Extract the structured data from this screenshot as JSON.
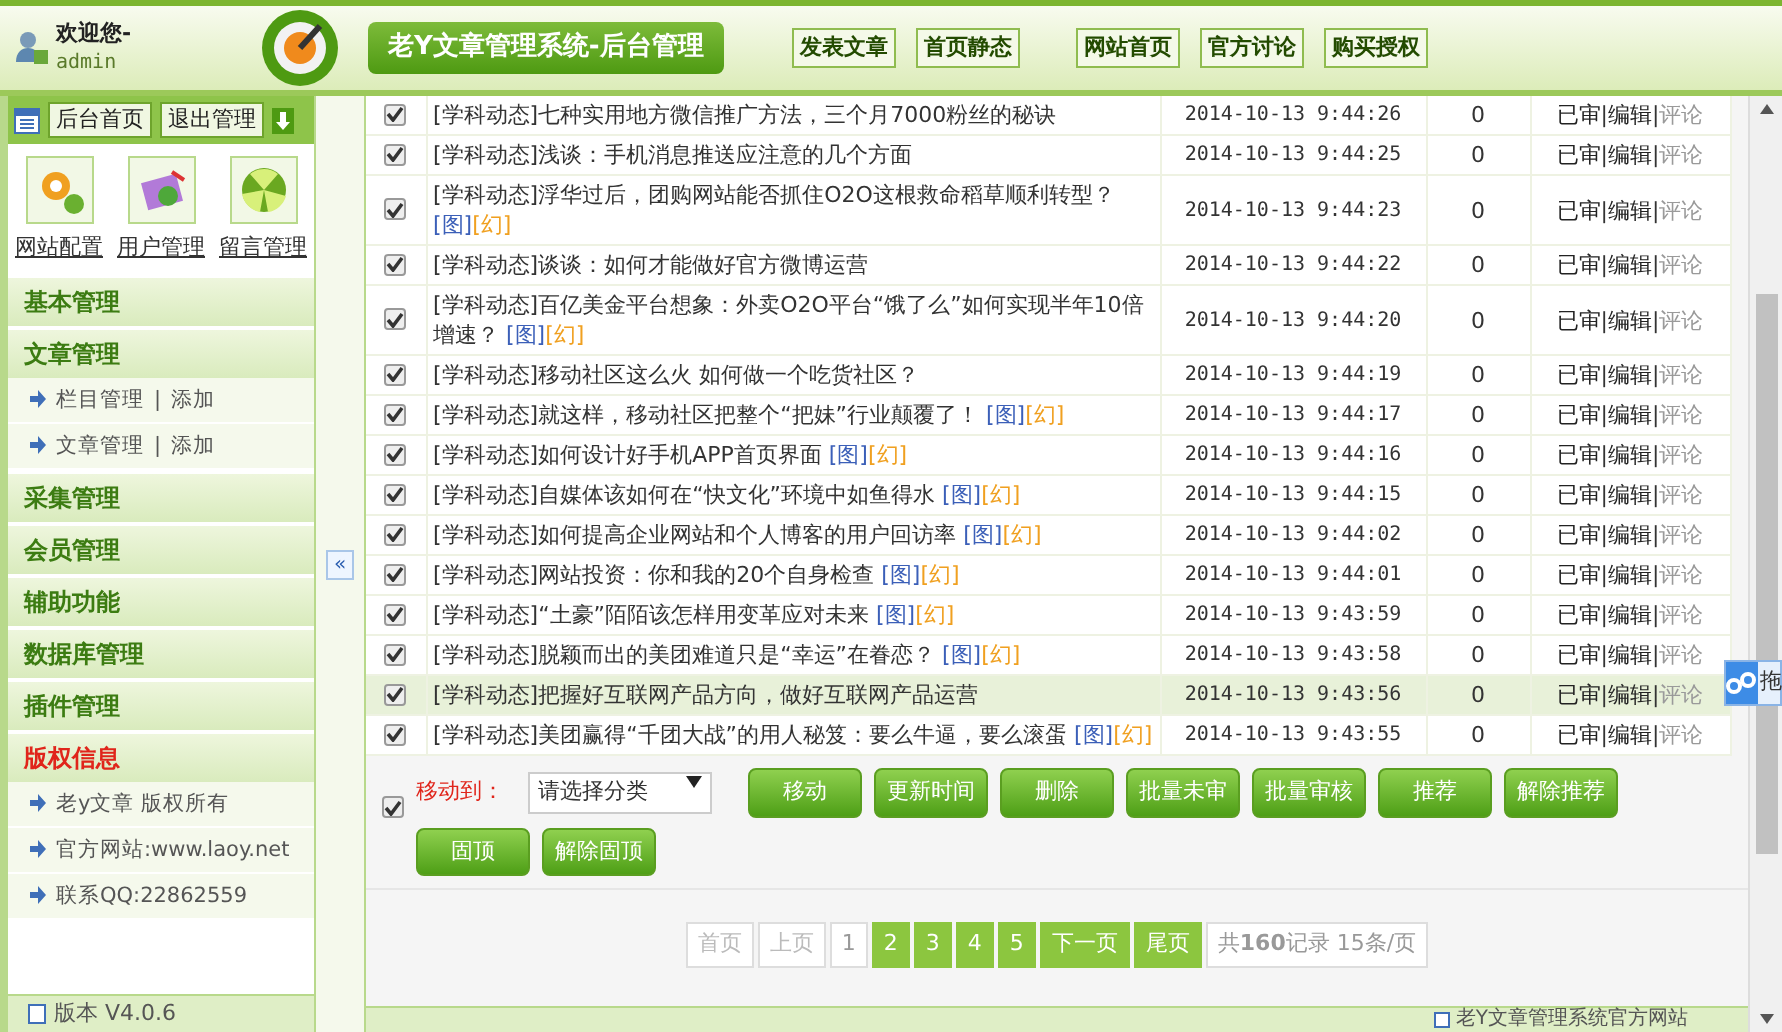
{
  "header": {
    "welcome": "欢迎您-",
    "user": "admin",
    "title": "老Y文章管理系统-后台管理",
    "links": [
      [
        "发表文章",
        "首页静态"
      ],
      [
        "网站首页",
        "官方讨论",
        "购买授权"
      ]
    ]
  },
  "sidebar": {
    "top_buttons": [
      "后台首页",
      "退出管理"
    ],
    "shortcuts": [
      {
        "label": "网站配置",
        "kind": "gears"
      },
      {
        "label": "用户管理",
        "kind": "notebook"
      },
      {
        "label": "留言管理",
        "kind": "globe"
      }
    ],
    "sections": [
      {
        "title": "基本管理",
        "kind": "menu"
      },
      {
        "title": "文章管理",
        "kind": "menu",
        "items": [
          {
            "text": "栏目管理",
            "separator": "|",
            "add": "添加"
          },
          {
            "text": "文章管理",
            "separator": "|",
            "add": "添加"
          }
        ]
      },
      {
        "title": "采集管理",
        "kind": "menu"
      },
      {
        "title": "会员管理",
        "kind": "menu"
      },
      {
        "title": "辅助功能",
        "kind": "menu"
      },
      {
        "title": "数据库管理",
        "kind": "menu"
      },
      {
        "title": "插件管理",
        "kind": "menu"
      },
      {
        "title": "版权信息",
        "kind": "info",
        "items": [
          {
            "text": "老y文章 版权所有"
          },
          {
            "text": "官方网站:www.laoy.net"
          },
          {
            "text": "联系QQ:22862559"
          }
        ]
      }
    ],
    "version": "版本 V4.0.6"
  },
  "collapse_button": "«",
  "table": {
    "rows": [
      {
        "checked": true,
        "highlighted": false,
        "category": "[学科动态]",
        "title": "七种实用地方微信推广方法，三个月7000粉丝的秘诀",
        "tags": [],
        "time": "2014-10-13 9:44:26",
        "count": "0",
        "actions": [
          {
            "text": "已审",
            "disabled": false
          },
          {
            "separator": "|",
            "text": "编辑",
            "disabled": false
          },
          {
            "separator": "|",
            "text": "评论",
            "disabled": true
          }
        ]
      },
      {
        "checked": true,
        "highlighted": false,
        "category": "[学科动态]",
        "title": "浅谈：手机消息推送应注意的几个方面",
        "tags": [],
        "time": "2014-10-13 9:44:25",
        "count": "0",
        "actions": [
          {
            "text": "已审",
            "disabled": false
          },
          {
            "separator": "|",
            "text": "编辑",
            "disabled": false
          },
          {
            "separator": "|",
            "text": "评论",
            "disabled": true
          }
        ]
      },
      {
        "checked": true,
        "highlighted": false,
        "category": "[学科动态]",
        "title": "浮华过后，团购网站能否抓住O2O这根救命稻草顺利转型？",
        "tags": [
          {
            "text": "[图]",
            "kind": "image"
          },
          {
            "text": "[幻]",
            "kind": "slide"
          }
        ],
        "time": "2014-10-13 9:44:23",
        "count": "0",
        "actions": [
          {
            "text": "已审",
            "disabled": false
          },
          {
            "separator": "|",
            "text": "编辑",
            "disabled": false
          },
          {
            "separator": "|",
            "text": "评论",
            "disabled": true
          }
        ]
      },
      {
        "checked": true,
        "highlighted": false,
        "category": "[学科动态]",
        "title": "谈谈：如何才能做好官方微博运营",
        "tags": [],
        "time": "2014-10-13 9:44:22",
        "count": "0",
        "actions": [
          {
            "text": "已审",
            "disabled": false
          },
          {
            "separator": "|",
            "text": "编辑",
            "disabled": false
          },
          {
            "separator": "|",
            "text": "评论",
            "disabled": true
          }
        ]
      },
      {
        "checked": true,
        "highlighted": false,
        "category": "[学科动态]",
        "title": "百亿美金平台想象：外卖O2O平台“饿了么”如何实现半年10倍增速？",
        "tags": [
          {
            "text": "[图]",
            "kind": "image"
          },
          {
            "text": "[幻]",
            "kind": "slide"
          }
        ],
        "time": "2014-10-13 9:44:20",
        "count": "0",
        "actions": [
          {
            "text": "已审",
            "disabled": false
          },
          {
            "separator": "|",
            "text": "编辑",
            "disabled": false
          },
          {
            "separator": "|",
            "text": "评论",
            "disabled": true
          }
        ]
      },
      {
        "checked": true,
        "highlighted": false,
        "category": "[学科动态]",
        "title": "移动社区这么火 如何做一个吃货社区？",
        "tags": [],
        "time": "2014-10-13 9:44:19",
        "count": "0",
        "actions": [
          {
            "text": "已审",
            "disabled": false
          },
          {
            "separator": "|",
            "text": "编辑",
            "disabled": false
          },
          {
            "separator": "|",
            "text": "评论",
            "disabled": true
          }
        ]
      },
      {
        "checked": true,
        "highlighted": false,
        "category": "[学科动态]",
        "title": "就这样，移动社区把整个“把妹”行业颠覆了！",
        "tags": [
          {
            "text": "[图]",
            "kind": "image"
          },
          {
            "text": "[幻]",
            "kind": "slide"
          }
        ],
        "time": "2014-10-13 9:44:17",
        "count": "0",
        "actions": [
          {
            "text": "已审",
            "disabled": false
          },
          {
            "separator": "|",
            "text": "编辑",
            "disabled": false
          },
          {
            "separator": "|",
            "text": "评论",
            "disabled": true
          }
        ]
      },
      {
        "checked": true,
        "highlighted": false,
        "category": "[学科动态]",
        "title": "如何设计好手机APP首页界面",
        "tags": [
          {
            "text": "[图]",
            "kind": "image"
          },
          {
            "text": "[幻]",
            "kind": "slide"
          }
        ],
        "time": "2014-10-13 9:44:16",
        "count": "0",
        "actions": [
          {
            "text": "已审",
            "disabled": false
          },
          {
            "separator": "|",
            "text": "编辑",
            "disabled": false
          },
          {
            "separator": "|",
            "text": "评论",
            "disabled": true
          }
        ]
      },
      {
        "checked": true,
        "highlighted": false,
        "category": "[学科动态]",
        "title": "自媒体该如何在“快文化”环境中如鱼得水",
        "tags": [
          {
            "text": "[图]",
            "kind": "image"
          },
          {
            "text": "[幻]",
            "kind": "slide"
          }
        ],
        "time": "2014-10-13 9:44:15",
        "count": "0",
        "actions": [
          {
            "text": "已审",
            "disabled": false
          },
          {
            "separator": "|",
            "text": "编辑",
            "disabled": false
          },
          {
            "separator": "|",
            "text": "评论",
            "disabled": true
          }
        ]
      },
      {
        "checked": true,
        "highlighted": false,
        "category": "[学科动态]",
        "title": "如何提高企业网站和个人博客的用户回访率",
        "tags": [
          {
            "text": "[图]",
            "kind": "image"
          },
          {
            "text": "[幻]",
            "kind": "slide"
          }
        ],
        "time": "2014-10-13 9:44:02",
        "count": "0",
        "actions": [
          {
            "text": "已审",
            "disabled": false
          },
          {
            "separator": "|",
            "text": "编辑",
            "disabled": false
          },
          {
            "separator": "|",
            "text": "评论",
            "disabled": true
          }
        ]
      },
      {
        "checked": true,
        "highlighted": false,
        "category": "[学科动态]",
        "title": "网站投资：你和我的20个自身检查",
        "tags": [
          {
            "text": "[图]",
            "kind": "image"
          },
          {
            "text": "[幻]",
            "kind": "slide"
          }
        ],
        "time": "2014-10-13 9:44:01",
        "count": "0",
        "actions": [
          {
            "text": "已审",
            "disabled": false
          },
          {
            "separator": "|",
            "text": "编辑",
            "disabled": false
          },
          {
            "separator": "|",
            "text": "评论",
            "disabled": true
          }
        ]
      },
      {
        "checked": true,
        "highlighted": false,
        "category": "[学科动态]",
        "title": "“土豪”陌陌该怎样用变革应对未来",
        "tags": [
          {
            "text": "[图]",
            "kind": "image"
          },
          {
            "text": "[幻]",
            "kind": "slide"
          }
        ],
        "time": "2014-10-13 9:43:59",
        "count": "0",
        "actions": [
          {
            "text": "已审",
            "disabled": false
          },
          {
            "separator": "|",
            "text": "编辑",
            "disabled": false
          },
          {
            "separator": "|",
            "text": "评论",
            "disabled": true
          }
        ]
      },
      {
        "checked": true,
        "highlighted": false,
        "category": "[学科动态]",
        "title": "脱颖而出的美团难道只是“幸运”在眷恋？",
        "tags": [
          {
            "text": "[图]",
            "kind": "image"
          },
          {
            "text": "[幻]",
            "kind": "slide"
          }
        ],
        "time": "2014-10-13 9:43:58",
        "count": "0",
        "actions": [
          {
            "text": "已审",
            "disabled": false
          },
          {
            "separator": "|",
            "text": "编辑",
            "disabled": false
          },
          {
            "separator": "|",
            "text": "评论",
            "disabled": true
          }
        ]
      },
      {
        "checked": true,
        "highlighted": true,
        "category": "[学科动态]",
        "title": "把握好互联网产品方向，做好互联网产品运营",
        "tags": [],
        "time": "2014-10-13 9:43:56",
        "count": "0",
        "actions": [
          {
            "text": "已审",
            "disabled": false
          },
          {
            "separator": "|",
            "text": "编辑",
            "disabled": false
          },
          {
            "separator": "|",
            "text": "评论",
            "disabled": true
          }
        ]
      },
      {
        "checked": true,
        "highlighted": false,
        "category": "[学科动态]",
        "title": "美团赢得“千团大战”的用人秘笈：要么牛逼，要么滚蛋",
        "tags": [
          {
            "text": "[图]",
            "kind": "image"
          },
          {
            "text": "[幻]",
            "kind": "slide"
          }
        ],
        "time": "2014-10-13 9:43:55",
        "count": "0",
        "actions": [
          {
            "text": "已审",
            "disabled": false
          },
          {
            "separator": "|",
            "text": "编辑",
            "disabled": false
          },
          {
            "separator": "|",
            "text": "评论",
            "disabled": true
          }
        ]
      }
    ]
  },
  "batch": {
    "select_all_checked": true,
    "move_label": "移动到：",
    "category_select": "请选择分类",
    "buttons": [
      "移动",
      "更新时间",
      "删除",
      "批量未审",
      "批量审核",
      "推荐",
      "解除推荐",
      "固顶",
      "解除固顶"
    ]
  },
  "pager": {
    "items": [
      {
        "text": "首页",
        "kind": "disabled"
      },
      {
        "text": "上页",
        "kind": "disabled"
      },
      {
        "text": "1",
        "kind": "current"
      },
      {
        "text": "2",
        "kind": "link"
      },
      {
        "text": "3",
        "kind": "link"
      },
      {
        "text": "4",
        "kind": "link"
      },
      {
        "text": "5",
        "kind": "link"
      },
      {
        "text": "下一页",
        "kind": "link"
      },
      {
        "text": "尾页",
        "kind": "link"
      }
    ],
    "summary": "共**160**记录 15条/页"
  },
  "footer_link": "老Y文章管理系统官方网站",
  "float_widget": {
    "text": "拖"
  }
}
